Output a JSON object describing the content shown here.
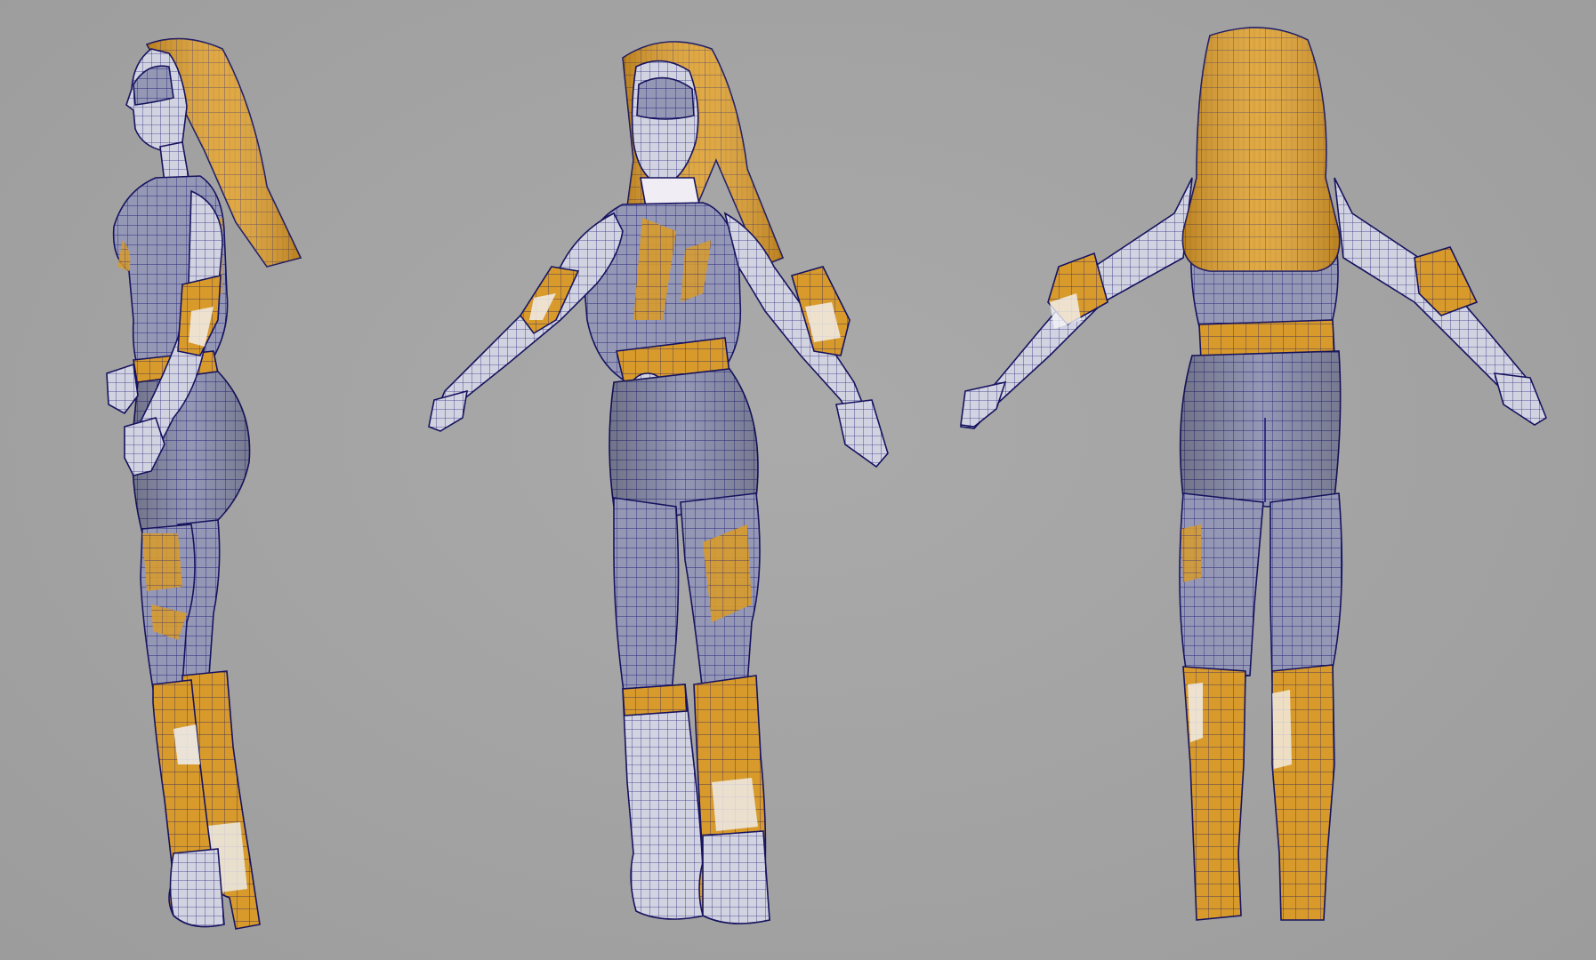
{
  "viewport": {
    "background_color": "#a3a3a3",
    "views": [
      "side-view",
      "three-quarter-view",
      "back-view"
    ]
  },
  "palette": {
    "suit": "#8f93b0",
    "suit_light": "#c9cbd9",
    "gold": "#d79a2a",
    "gold_dark": "#a96e12",
    "wire": "#1d1a7a",
    "highlight": "#f2f2f6"
  }
}
